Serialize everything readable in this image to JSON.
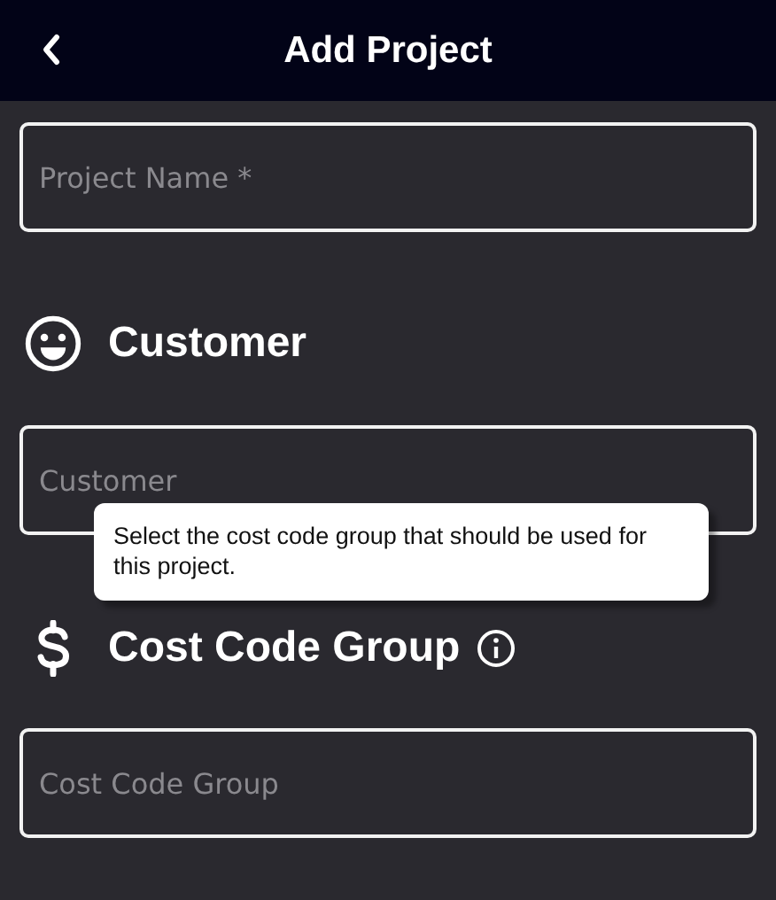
{
  "header": {
    "title": "Add Project"
  },
  "sections": [
    {
      "field": {
        "placeholder": "Project Name *"
      }
    },
    {
      "heading": {
        "text": "Customer",
        "kind": "customer",
        "info": false
      },
      "field": {
        "placeholder": "Customer"
      }
    },
    {
      "heading": {
        "text": "Cost Code Group",
        "kind": "cost",
        "info": true
      },
      "field": {
        "placeholder": "Cost Code Group"
      }
    }
  ],
  "tooltip": {
    "text": "Select the cost code group that should be used for this project."
  }
}
